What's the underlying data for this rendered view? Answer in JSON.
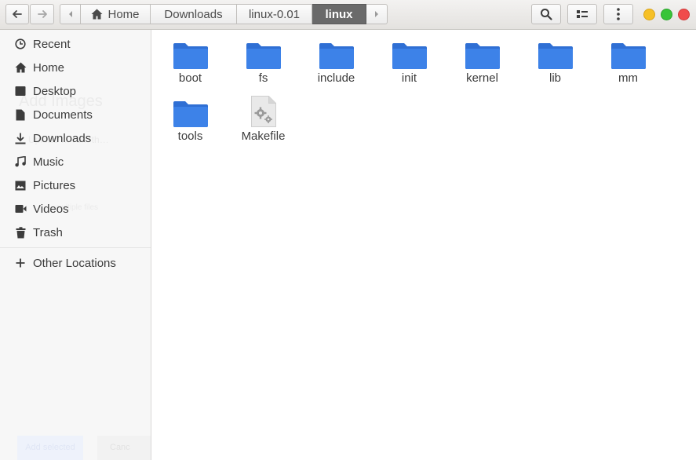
{
  "headerbar": {
    "nav": {
      "back": "back-arrow",
      "forward": "forward-arrow"
    },
    "path": [
      "Home",
      "Downloads",
      "linux-0.01",
      "linux"
    ],
    "active_index": 3,
    "actions": [
      "search",
      "view-options",
      "menu"
    ]
  },
  "sidebar": {
    "items": [
      {
        "label": "Recent",
        "icon": "clock-icon"
      },
      {
        "label": "Home",
        "icon": "home-icon"
      },
      {
        "label": "Desktop",
        "icon": "desktop-icon"
      },
      {
        "label": "Documents",
        "icon": "documents-icon"
      },
      {
        "label": "Downloads",
        "icon": "download-icon"
      },
      {
        "label": "Music",
        "icon": "music-icon"
      },
      {
        "label": "Pictures",
        "icon": "pictures-icon"
      },
      {
        "label": "Videos",
        "icon": "videos-icon"
      },
      {
        "label": "Trash",
        "icon": "trash-icon"
      }
    ],
    "other": {
      "label": "Other Locations",
      "icon": "plus-icon"
    },
    "ghost_text": {
      "heading": "Add Images",
      "line": "Upload … rom th…",
      "multiple": "multiple files",
      "add_selected": "Add selected",
      "cancel": "Canc"
    }
  },
  "files": [
    {
      "name": "boot",
      "type": "folder"
    },
    {
      "name": "fs",
      "type": "folder"
    },
    {
      "name": "include",
      "type": "folder"
    },
    {
      "name": "init",
      "type": "folder"
    },
    {
      "name": "kernel",
      "type": "folder"
    },
    {
      "name": "lib",
      "type": "folder"
    },
    {
      "name": "mm",
      "type": "folder"
    },
    {
      "name": "tools",
      "type": "folder"
    },
    {
      "name": "Makefile",
      "type": "makefile"
    }
  ],
  "colors": {
    "folder": "#3d82e8",
    "folder_tab": "#2f6fd4",
    "close": "#f04c4c",
    "minimize": "#f6c026",
    "maximize": "#38c438",
    "active_crumb": "#6a6a6a"
  }
}
